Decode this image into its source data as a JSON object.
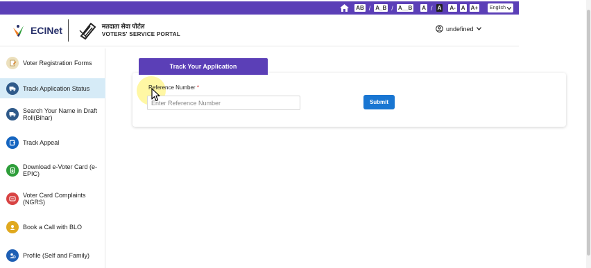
{
  "topbar": {
    "font_options": [
      "AB",
      "A_B",
      "A__B"
    ],
    "contrast_options": [
      "A",
      "A"
    ],
    "size_options": [
      "A-",
      "A",
      "A+"
    ],
    "language": "English"
  },
  "header": {
    "brand": "ECINet",
    "portal_hindi": "मतदाता सेवा पोर्टल",
    "portal_english": "VOTERS' SERVICE PORTAL",
    "user_name": "undefined"
  },
  "sidebar": {
    "items": [
      {
        "label": "Voter Registration Forms",
        "icon": "forms-icon",
        "color": "#e8d9b0"
      },
      {
        "label": "Track Application Status",
        "icon": "truck-icon",
        "color": "#2f5a8a",
        "active": true
      },
      {
        "label": "Search Your Name in Draft Roll(Bihar)",
        "icon": "truck-icon",
        "color": "#2f5a8a"
      },
      {
        "label": "Track Appeal",
        "icon": "appeal-icon",
        "color": "#1565c0"
      },
      {
        "label": "Download e-Voter Card (e-EPIC)",
        "icon": "download-icon",
        "color": "#2e9e3a"
      },
      {
        "label": "Voter Card Complaints (NGRS)",
        "icon": "complaint-icon",
        "color": "#d84343"
      },
      {
        "label": "Book a Call with BLO",
        "icon": "phone-icon",
        "color": "#e0a91f"
      },
      {
        "label": "Profile (Self and Family)",
        "icon": "profile-icon",
        "color": "#1e5fb4"
      }
    ]
  },
  "main": {
    "tab_label": "Track Your Application",
    "reference_label": "Reference Number",
    "required_mark": "*",
    "reference_placeholder": "Enter Reference Number",
    "submit_label": "Submit"
  },
  "colors": {
    "accent": "#5b3fb7",
    "button": "#1976d2",
    "active_bg": "#d6ebf7"
  }
}
